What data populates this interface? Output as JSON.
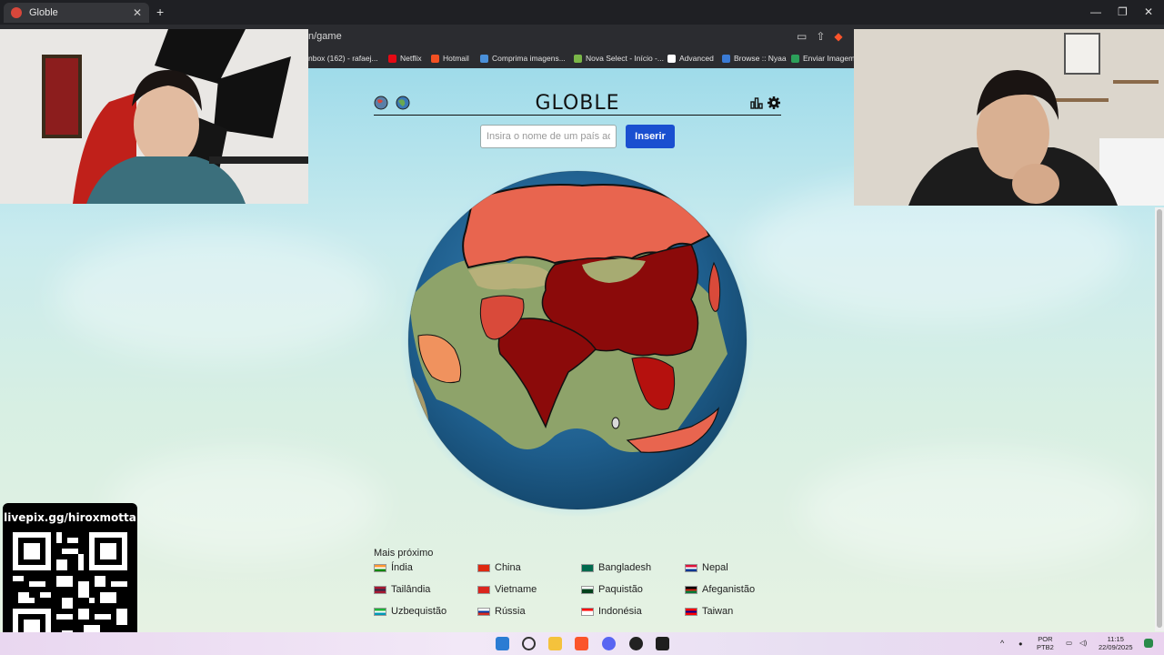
{
  "browser": {
    "tab_title": "Globle",
    "url_fragment": "n/game",
    "bookmarks": [
      {
        "label": "nbox (162) - rafaej...",
        "color": "#bbbbbb"
      },
      {
        "label": "Netflix",
        "color": "#e50914"
      },
      {
        "label": "Hotmail",
        "color": "#f25022"
      },
      {
        "label": "Comprima imagens...",
        "color": "#4a90d9"
      },
      {
        "label": "Nova Select - Início -...",
        "color": "#7ab648"
      },
      {
        "label": "Advanced",
        "color": "#ffffff"
      },
      {
        "label": "Browse :: Nyaa",
        "color": "#3a7bd5"
      },
      {
        "label": "Enviar Imagem",
        "color": "#2ca05a"
      }
    ]
  },
  "game": {
    "title": "GLOBLE",
    "icons": {
      "left": [
        "globe-alt-icon",
        "globe-icon"
      ],
      "right": [
        "stats-icon",
        "settings-icon"
      ]
    },
    "input_placeholder": "Insira o nome de um país aqui",
    "insert_label": "Inserir",
    "results_title": "Mais próximo",
    "countries": [
      {
        "name": "Índia",
        "flag": [
          "#ff9933",
          "#ffffff",
          "#138808"
        ]
      },
      {
        "name": "China",
        "flag": [
          "#de2910",
          "#de2910",
          "#de2910"
        ]
      },
      {
        "name": "Bangladesh",
        "flag": [
          "#006a4e",
          "#006a4e",
          "#006a4e"
        ]
      },
      {
        "name": "Nepal",
        "flag": [
          "#dc143c",
          "#ffffff",
          "#003893"
        ]
      },
      {
        "name": "Tailândia",
        "flag": [
          "#a51931",
          "#2d2a4a",
          "#a51931"
        ]
      },
      {
        "name": "Vietname",
        "flag": [
          "#da251d",
          "#da251d",
          "#da251d"
        ]
      },
      {
        "name": "Paquistão",
        "flag": [
          "#ffffff",
          "#01411c",
          "#01411c"
        ]
      },
      {
        "name": "Afeganistão",
        "flag": [
          "#000000",
          "#d32011",
          "#007a36"
        ]
      },
      {
        "name": "Uzbequistão",
        "flag": [
          "#1eb53a",
          "#ffffff",
          "#0099b5"
        ]
      },
      {
        "name": "Rússia",
        "flag": [
          "#ffffff",
          "#0039a6",
          "#d52b1e"
        ]
      },
      {
        "name": "Indonésia",
        "flag": [
          "#ff0000",
          "#ffffff",
          "#ffffff"
        ]
      },
      {
        "name": "Taiwan",
        "flag": [
          "#fe0000",
          "#000095",
          "#fe0000"
        ]
      }
    ]
  },
  "overlay": {
    "livepix_label": "livepix.gg/hiroxmotta"
  },
  "taskbar": {
    "lang_top": "POR",
    "lang_bottom": "PTB2",
    "time": "11:15",
    "date": "22/09/2025"
  }
}
